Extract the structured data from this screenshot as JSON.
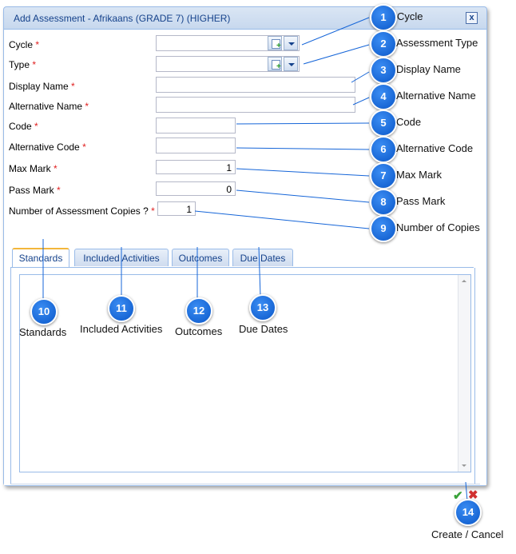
{
  "dialog": {
    "title": "Add Assessment - Afrikaans (GRADE 7) (HIGHER)",
    "close_glyph": "x"
  },
  "form": {
    "cycle_label": "Cycle",
    "type_label": "Type",
    "display_name_label": "Display Name",
    "alternative_name_label": "Alternative Name",
    "code_label": "Code",
    "alternative_code_label": "Alternative Code",
    "max_mark_label": "Max Mark",
    "max_mark_value": "1",
    "pass_mark_label": "Pass Mark",
    "pass_mark_value": "0",
    "copies_label": "Number of Assessment Copies ?",
    "copies_value": "1",
    "required_marker": "*"
  },
  "tabs": [
    {
      "label": "Standards",
      "active": true
    },
    {
      "label": "Included Activities",
      "active": false
    },
    {
      "label": "Outcomes",
      "active": false
    },
    {
      "label": "Due Dates",
      "active": false
    }
  ],
  "footer": {
    "ok_icon": "check-icon",
    "cancel_icon": "cross-icon",
    "ok_glyph": "✔",
    "cancel_glyph": "✖"
  },
  "callouts": [
    {
      "num": "1",
      "text": "Cycle"
    },
    {
      "num": "2",
      "text": "Assessment Type"
    },
    {
      "num": "3",
      "text": "Display Name"
    },
    {
      "num": "4",
      "text": "Alternative Name"
    },
    {
      "num": "5",
      "text": "Code"
    },
    {
      "num": "6",
      "text": "Alternative Code"
    },
    {
      "num": "7",
      "text": "Max Mark"
    },
    {
      "num": "8",
      "text": "Pass Mark"
    },
    {
      "num": "9",
      "text": "Number of Copies"
    },
    {
      "num": "10",
      "text": "Standards"
    },
    {
      "num": "11",
      "text": "Included Activities"
    },
    {
      "num": "12",
      "text": "Outcomes"
    },
    {
      "num": "13",
      "text": "Due Dates"
    },
    {
      "num": "14",
      "text": "Create / Cancel"
    }
  ],
  "colors": {
    "accent": "#0a57c9",
    "title_text": "#15428b",
    "border": "#99bbe8",
    "required": "#e02020"
  }
}
